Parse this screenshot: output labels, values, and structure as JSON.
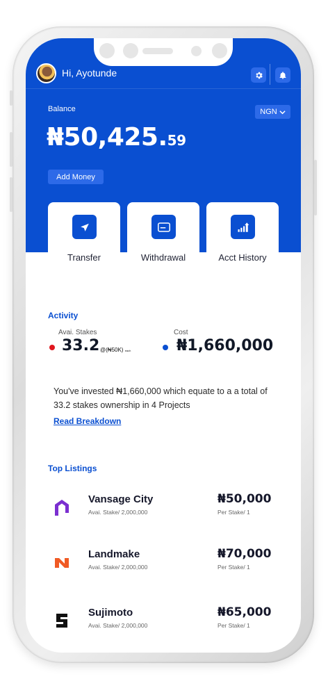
{
  "header": {
    "greeting": "Hi, Ayotunde",
    "avatar_icon": "user-avatar",
    "settings_icon": "gear-icon",
    "notifications_icon": "bell-icon"
  },
  "balance": {
    "label": "Balance",
    "currency": "NGN",
    "amount_main": "₦50,425.",
    "amount_decimal": "59",
    "add_money_label": "Add Money"
  },
  "actions": [
    {
      "label": "Transfer",
      "icon": "send-icon"
    },
    {
      "label": "Withdrawal",
      "icon": "card-icon"
    },
    {
      "label": "Acct History",
      "icon": "chart-up-icon"
    }
  ],
  "activity": {
    "title": "Activity",
    "stakes_label": "Avai. Stakes",
    "stakes_value": "33.2",
    "stakes_rate": "@(₦50K)",
    "stakes_suffix": "each",
    "cost_label": "Cost",
    "cost_value": "₦1,660,000",
    "description": "You've invested ₦1,660,000 which equate to a a total of 33.2 stakes ownership in 4 Projects",
    "read_link": "Read Breakdown"
  },
  "listings": {
    "title": "Top Listings",
    "items": [
      {
        "name": "Vansage City",
        "sub": "Avai. Stake/ 2,000,000",
        "price": "₦50,000",
        "per": "Per Stake/ 1",
        "color": "#7b2fd0"
      },
      {
        "name": "Landmake",
        "sub": "Avai. Stake/ 2,000,000",
        "price": "₦70,000",
        "per": "Per Stake/ 1",
        "color": "#f05a24"
      },
      {
        "name": "Sujimoto",
        "sub": "Avai. Stake/ 2,000,000",
        "price": "₦65,000",
        "per": "Per Stake/ 1",
        "color": "#111111"
      }
    ]
  },
  "colors": {
    "primary": "#0a4fd1",
    "accent_red": "#e0161e"
  }
}
